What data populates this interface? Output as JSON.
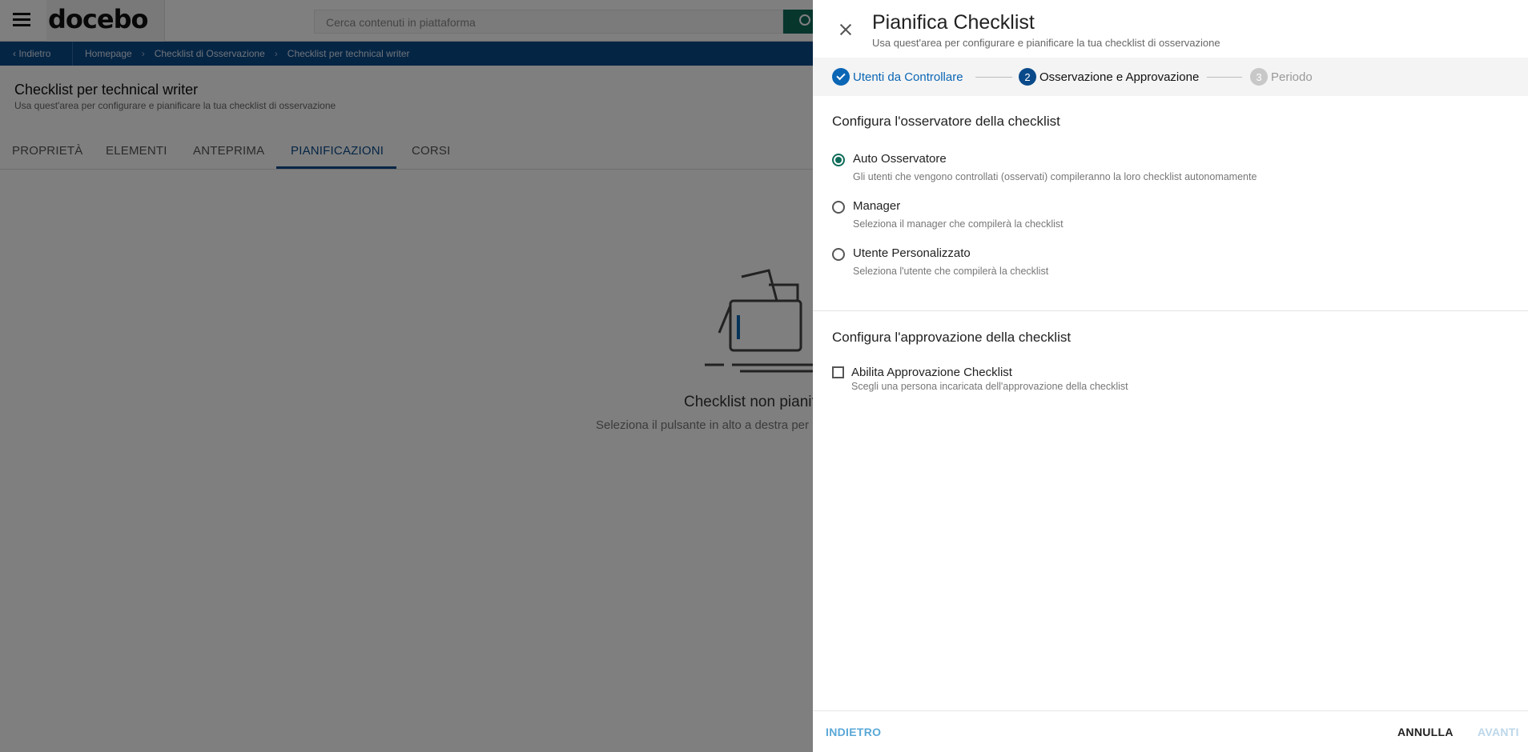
{
  "background": {
    "logo": "docebo",
    "search_placeholder": "Cerca contenuti in piattaforma",
    "breadcrumb": {
      "back": "Indietro",
      "items": [
        "Homepage",
        "Checklist di Osservazione",
        "Checklist per technical writer"
      ]
    },
    "page_title": "Checklist per technical writer",
    "page_subtitle": "Usa quest'area per configurare e pianificare la tua checklist di osservazione",
    "tabs": [
      "PROPRIETÀ",
      "ELEMENTI",
      "ANTEPRIMA",
      "PIANIFICAZIONI",
      "CORSI"
    ],
    "active_tab": "PIANIFICAZIONI",
    "empty_title": "Checklist non pianificata",
    "empty_subtitle": "Seleziona il pulsante in alto a destra per"
  },
  "panel": {
    "title": "Pianifica Checklist",
    "subtitle": "Usa quest'area per configurare e pianificare la tua checklist di osservazione",
    "steps": [
      {
        "number": "1",
        "label": "Utenti da Controllare",
        "state": "done"
      },
      {
        "number": "2",
        "label": "Osservazione e Approvazione",
        "state": "active"
      },
      {
        "number": "3",
        "label": "Periodo",
        "state": "todo"
      }
    ],
    "observer_section": {
      "title": "Configura l'osservatore della checklist",
      "options": [
        {
          "label": "Auto Osservatore",
          "description": "Gli utenti che vengono controllati (osservati) compileranno la loro checklist autonomamente",
          "selected": true
        },
        {
          "label": "Manager",
          "description": "Seleziona il manager che compilerà la checklist",
          "selected": false
        },
        {
          "label": "Utente Personalizzato",
          "description": "Seleziona l'utente che compilerà la checklist",
          "selected": false
        }
      ]
    },
    "approval_section": {
      "title": "Configura l'approvazione della checklist",
      "checkbox_label": "Abilita Approvazione Checklist",
      "checkbox_description": "Scegli una persona incaricata dell'approvazione della checklist",
      "checked": false
    },
    "footer": {
      "back": "INDIETRO",
      "cancel": "ANNULLA",
      "next": "AVANTI"
    }
  },
  "colors": {
    "primary_blue": "#0b4a8a",
    "accent_green": "#0f6c5a",
    "link_blue": "#0b66b5"
  }
}
